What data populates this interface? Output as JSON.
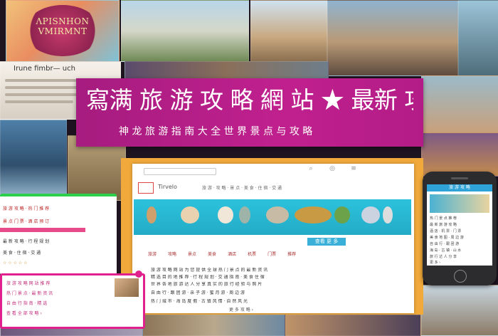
{
  "poster": {
    "line1": "ΛPISNHON",
    "line2": "VMIRMNT"
  },
  "strip": {
    "label": "Irune fimbr— uch"
  },
  "banner": {
    "title": "寫满 旅 游 攻 略 網 站 ★ 最新 攻略",
    "subtitle": "神 龙 旅 游 指 南 大 全 世 界 景 点 与 攻 略"
  },
  "site": {
    "logo_text": "Tirvelo",
    "nav": "旅 游 · 攻 略 · 景 点 · 美 食 · 住 宿 · 交 通",
    "cta": "查看 更 多",
    "menu": [
      "旅游",
      "攻略",
      "景点",
      "美食",
      "酒店",
      "机票",
      "门票",
      "推荐"
    ],
    "paragraphs": [
      "旅 游 攻 略 网 站 为 您 提 供 全 球 热 门 景 点 的 最 新 资 讯",
      "精 选 目 的 地 推 荐 · 行 程 规 划 · 交 通 指 南 · 美 食 住 宿",
      "世 界 各 地 旅 游 达 人 分 享 真 实 的 旅 行 经 验 与 照 片",
      "自 由 行 · 跟 团 游 · 亲 子 游 · 蜜 月 游 · 周 边 游",
      "热 门 城 市 · 海 岛 度 假 · 古 镇 风 情 · 自 然 风 光"
    ],
    "footer": "更 多 攻 略 ›"
  },
  "card1": {
    "rows": [
      "旅 游 攻 略 · 热 门 推 荐",
      "景 点 门 票 · 酒 店 预 订",
      "最 新 攻 略 · 行 程 规 划",
      "美 食 · 住 宿 · 交 通",
      "☆ ☆ ☆ ☆ ☆"
    ]
  },
  "card2": {
    "rows": [
      "旅 游 攻 略 网 站 推 荐",
      "热 门 景 点 · 最 新 资 讯",
      "自 由 行 指 南 · 精 选",
      "查 看 全 部 攻 略 ›"
    ]
  },
  "phone": {
    "header": "旅 游 攻 略",
    "lines": [
      "热 门 景 点 推 荐",
      "最 新 旅 游 攻 略",
      "酒 店 · 机 票 · 门 票",
      "美 食 地 图 · 周 边 游",
      "自 由 行 · 跟 团 游",
      "海 岛 · 古 镇 · 山 水",
      "旅 行 达 人 分 享",
      "更 多 ›"
    ]
  },
  "icons": {
    "search": "search-icon",
    "user": "user-icon",
    "menu": "menu-icon"
  },
  "colors": {
    "banner": "#b31c86",
    "hero": "#2cc2dc",
    "frame": "#f0a93a",
    "card_accent": "#e0208c"
  }
}
